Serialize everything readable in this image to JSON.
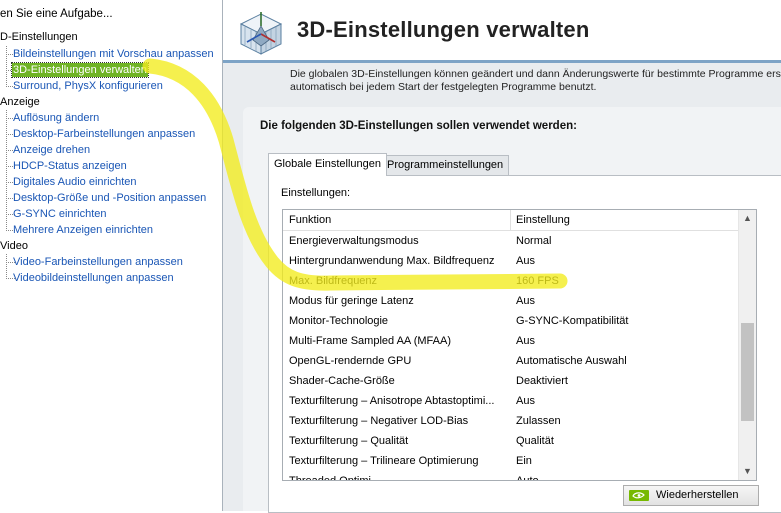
{
  "left_pane": {
    "header": "en Sie eine Aufgabe...",
    "categories": [
      {
        "label": "D-Einstellungen",
        "items": [
          {
            "label": "Bildeinstellungen mit Vorschau anpassen"
          },
          {
            "label": "3D-Einstellungen verwalten",
            "selected": true
          },
          {
            "label": "Surround, PhysX konfigurieren"
          }
        ]
      },
      {
        "label": "Anzeige",
        "items": [
          {
            "label": "Auflösung ändern"
          },
          {
            "label": "Desktop-Farbeinstellungen anpassen"
          },
          {
            "label": "Anzeige drehen"
          },
          {
            "label": "HDCP-Status anzeigen"
          },
          {
            "label": "Digitales Audio einrichten"
          },
          {
            "label": "Desktop-Größe und -Position anpassen"
          },
          {
            "label": "G-SYNC einrichten"
          },
          {
            "label": "Mehrere Anzeigen einrichten"
          }
        ]
      },
      {
        "label": "Video",
        "items": [
          {
            "label": "Video-Farbeinstellungen anpassen"
          },
          {
            "label": "Videobildeinstellungen anpassen"
          }
        ]
      }
    ]
  },
  "main": {
    "title": "3D-Einstellungen verwalten",
    "description_line1": "Die globalen 3D-Einstellungen können geändert und dann Änderungswerte für bestimmte Programme ers",
    "description_line2": "automatisch bei jedem Start der festgelegten Programme benutzt.",
    "panel_heading": "Die folgenden 3D-Einstellungen sollen verwendet werden:",
    "tabs": [
      {
        "label": "Globale Einstellungen",
        "active": true
      },
      {
        "label": "Programmeinstellungen",
        "active": false
      }
    ],
    "settings_label": "Einstellungen:",
    "table": {
      "headers": [
        "Funktion",
        "Einstellung"
      ],
      "rows": [
        [
          "Energieverwaltungsmodus",
          "Normal"
        ],
        [
          "Hintergrundanwendung Max. Bildfrequenz",
          "Aus"
        ],
        [
          "Max. Bildfrequenz",
          "160 FPS"
        ],
        [
          "Modus für geringe Latenz",
          "Aus"
        ],
        [
          "Monitor-Technologie",
          "G-SYNC-Kompatibilität"
        ],
        [
          "Multi-Frame Sampled AA (MFAA)",
          "Aus"
        ],
        [
          "OpenGL-rendernde GPU",
          "Automatische Auswahl"
        ],
        [
          "Shader-Cache-Größe",
          "Deaktiviert"
        ],
        [
          "Texturfilterung – Anisotrope Abtastoptimi...",
          "Aus"
        ],
        [
          "Texturfilterung – Negativer LOD-Bias",
          "Zulassen"
        ],
        [
          "Texturfilterung – Qualität",
          "Qualität"
        ],
        [
          "Texturfilterung – Trilineare Optimierung",
          "Ein"
        ],
        [
          "Threaded Optimi...",
          "Auto"
        ]
      ]
    },
    "restore_button": "Wiederherstellen"
  },
  "colors": {
    "accent_highlight": "#f2ec1c",
    "selected_item": "#6fb324",
    "link": "#1a56b5",
    "nvidia_green": "#76b900"
  },
  "icons": [
    "cube-3d-icon",
    "nvidia-logo-icon",
    "chevron-up-icon",
    "chevron-down-icon"
  ]
}
